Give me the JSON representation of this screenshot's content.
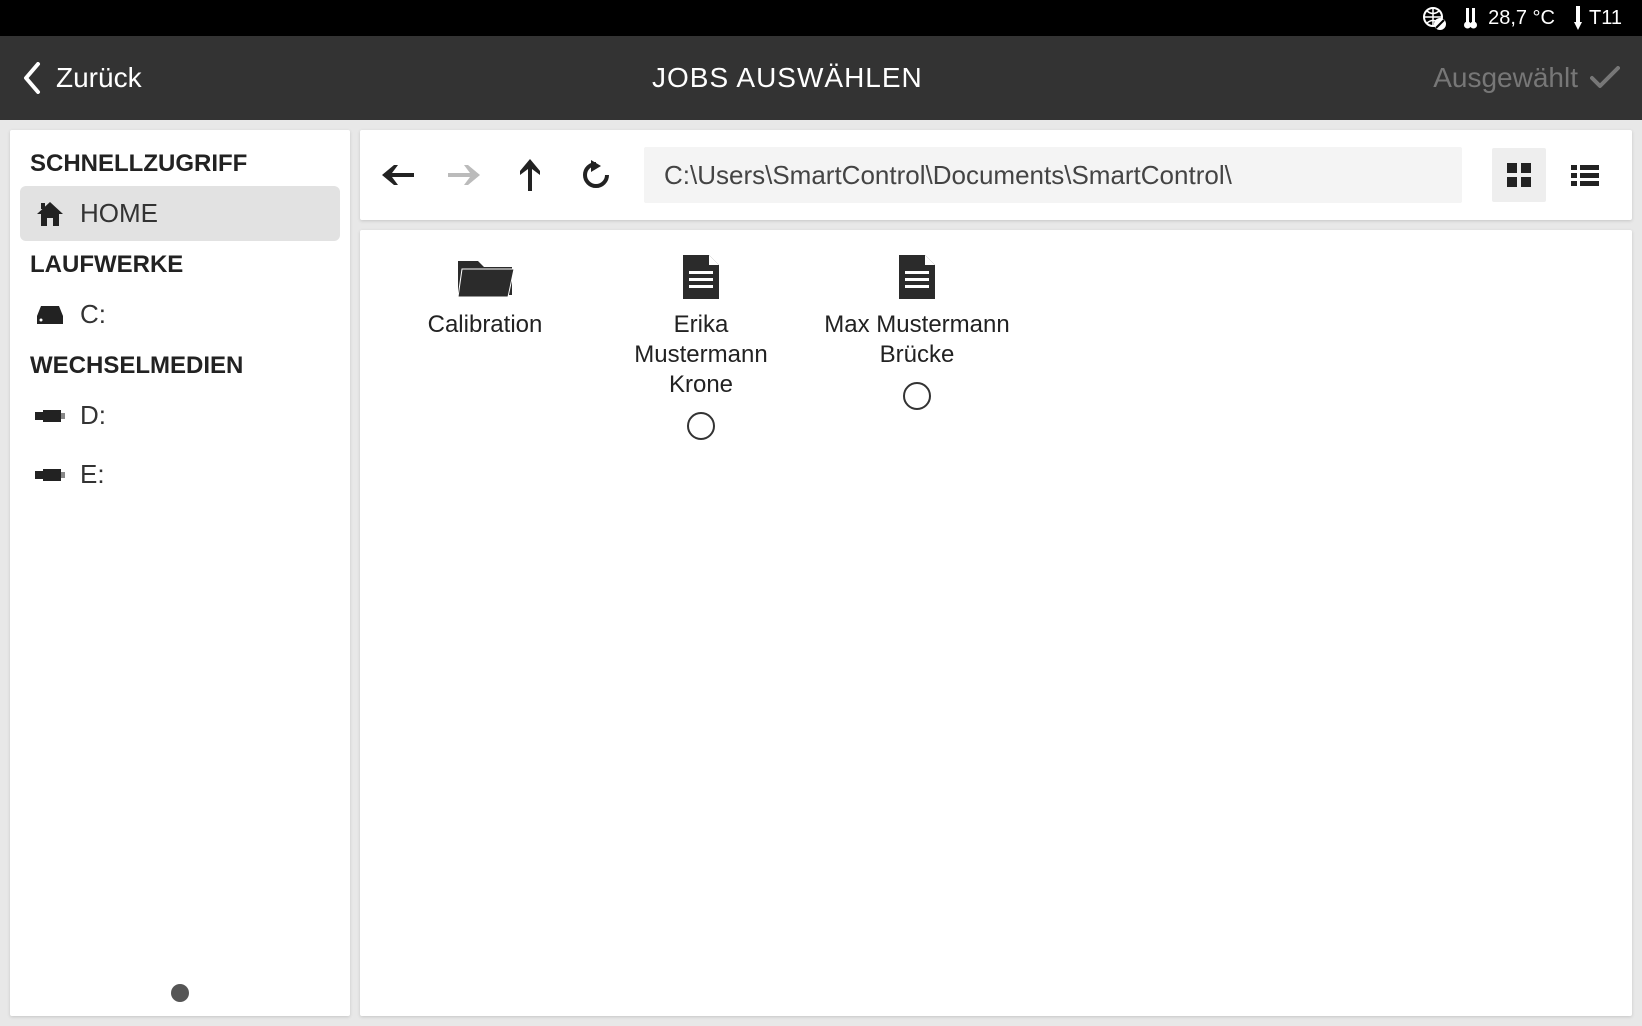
{
  "status": {
    "temp": "28,7 °C",
    "tool": "T11"
  },
  "header": {
    "back_label": "Zurück",
    "title": "JOBS AUSWÄHLEN",
    "select_label": "Ausgewählt"
  },
  "sidebar": {
    "sections": {
      "quick_label": "SCHNELLZUGRIFF",
      "drives_label": "LAUFWERKE",
      "removable_label": "WECHSELMEDIEN"
    },
    "home_label": "HOME",
    "drive_c": "C:",
    "drive_d": "D:",
    "drive_e": "E:"
  },
  "toolbar": {
    "path": "C:\\Users\\SmartControl\\Documents\\SmartControl\\"
  },
  "files": [
    {
      "type": "folder",
      "name": "Calibration",
      "selectable": false
    },
    {
      "type": "file",
      "name": "Erika Mustermann Krone",
      "selectable": true
    },
    {
      "type": "file",
      "name": "Max Mustermann Brücke",
      "selectable": true
    }
  ]
}
